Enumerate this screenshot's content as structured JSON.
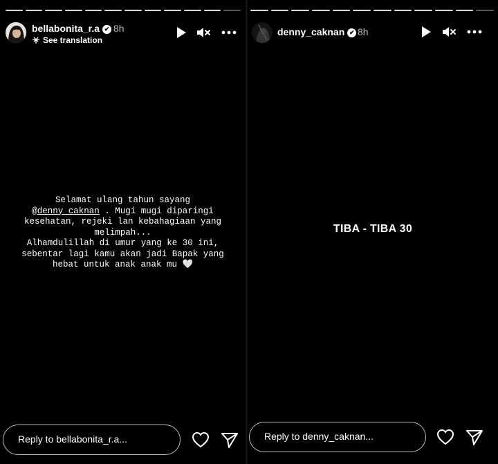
{
  "left_story": {
    "username": "bellabonita_r.a",
    "verified_badge": "✔",
    "time": "8h",
    "see_translation": "See translation",
    "caption_lines": [
      "Selamat ulang tahun sayang",
      " . Mugi mugi diparingi",
      "kesehatan, rejeki lan kebahagiaan yang",
      "melimpah...",
      "Alhamdulillah di umur yang ke 30 ini,",
      "sebentar lagi kamu akan jadi Bapak yang",
      "hebat untuk anak anak mu"
    ],
    "mention": "@denny_caknan",
    "heart_emoji": "🤍",
    "reply_placeholder": "Reply to bellabonita_r.a..."
  },
  "right_story": {
    "username": "denny_caknan",
    "verified_badge": "✔",
    "time": "8h",
    "story_text": "TIBA - TIBA 30",
    "reply_placeholder": "Reply to denny_caknan..."
  },
  "icons": {
    "play": "play-icon",
    "mute": "muted-speaker-icon",
    "more": "more-options-icon",
    "like": "heart-icon",
    "share": "send-icon"
  },
  "colors": {
    "background": "#000000",
    "text": "#ffffff",
    "muted_text": "#bbbbbb"
  }
}
